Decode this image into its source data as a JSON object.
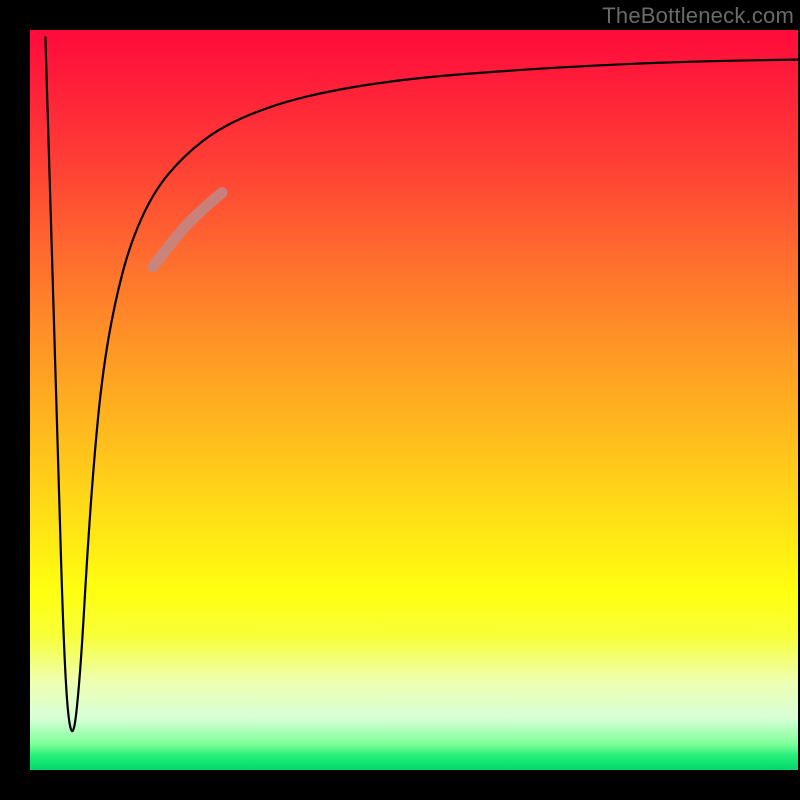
{
  "watermark": "TheBottleneck.com",
  "chart_data": {
    "type": "line",
    "title": "",
    "xlabel": "",
    "ylabel": "",
    "xlim": [
      0,
      100
    ],
    "ylim": [
      0,
      100
    ],
    "grid": false,
    "legend": false,
    "background_gradient": {
      "top_color": "#ff0b3b",
      "mid_color": "#ffff10",
      "bottom_color": "#00d86a"
    },
    "series": [
      {
        "name": "bottleneck-curve",
        "color": "#000000",
        "x": [
          2.0,
          3.5,
          4.5,
          5.5,
          6.5,
          7.5,
          8.5,
          9.5,
          11.0,
          13.0,
          16.0,
          20.0,
          25.0,
          32.0,
          40.0,
          50.0,
          62.0,
          75.0,
          88.0,
          100.0
        ],
        "y": [
          99.0,
          48.0,
          12.0,
          3.0,
          12.0,
          30.0,
          44.0,
          54.0,
          63.0,
          71.0,
          78.0,
          83.0,
          87.0,
          90.0,
          92.0,
          93.5,
          94.5,
          95.3,
          95.8,
          96.0
        ]
      },
      {
        "name": "highlight-segment",
        "color": "#c08888",
        "thick": true,
        "x": [
          16.0,
          17.5,
          19.0,
          20.5,
          22.0,
          23.5,
          25.0
        ],
        "y": [
          68.0,
          70.0,
          72.0,
          73.8,
          75.3,
          76.7,
          78.0
        ]
      }
    ]
  }
}
